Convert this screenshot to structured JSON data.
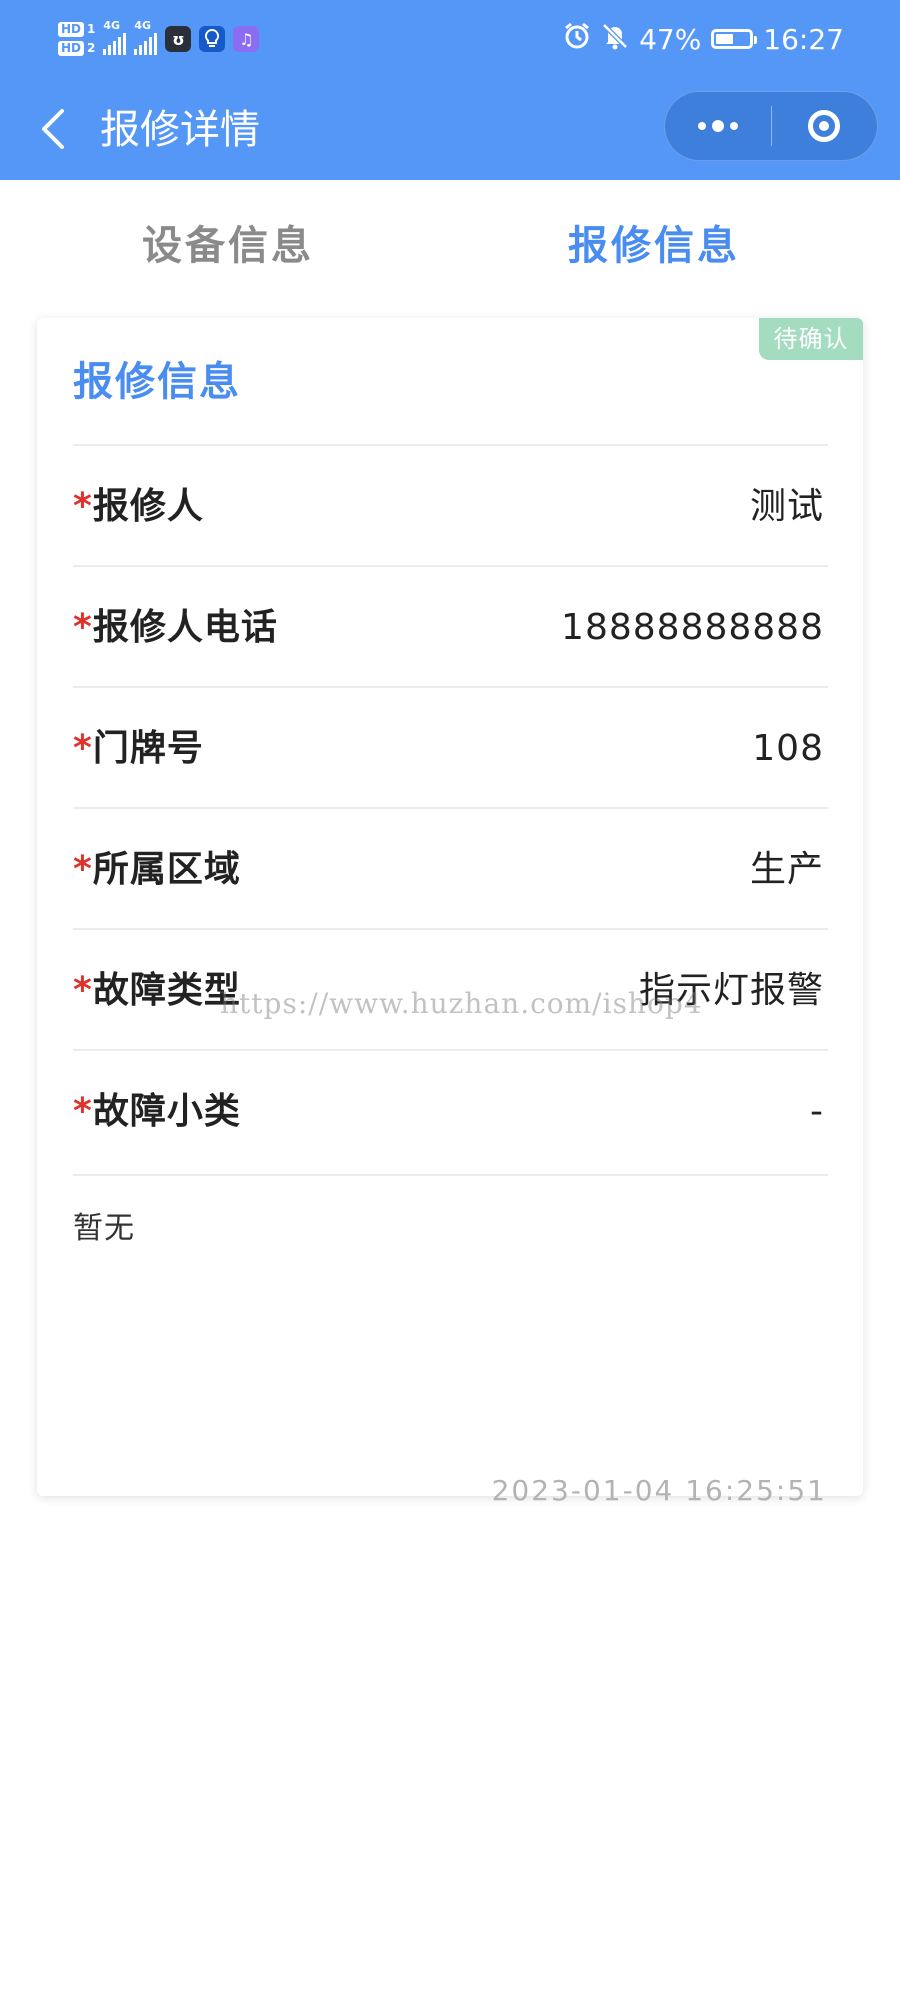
{
  "status_bar": {
    "sim1": "HD",
    "sim1_num": "1",
    "sim2": "HD",
    "sim2_num": "2",
    "net1": "4G",
    "net2": "4G",
    "battery_percent": "47%",
    "battery_level": 0.47,
    "time": "16:27",
    "icons": [
      "alarm-icon",
      "mute-bell-icon",
      "battery-icon"
    ]
  },
  "nav": {
    "title": "报修详情",
    "back_icon": "chevron-left-icon",
    "more_icon": "more-dots-icon",
    "close_icon": "target-icon"
  },
  "tabs": [
    {
      "label": "设备信息",
      "active": false
    },
    {
      "label": "报修信息",
      "active": true
    }
  ],
  "card": {
    "status": "待确认",
    "title": "报修信息",
    "fields": [
      {
        "label": "报修人",
        "value": "测试"
      },
      {
        "label": "报修人电话",
        "value": "18888888888"
      },
      {
        "label": "门牌号",
        "value": "108"
      },
      {
        "label": "所属区域",
        "value": "生产"
      },
      {
        "label": "故障类型",
        "value": "指示灯报警"
      },
      {
        "label": "故障小类",
        "value": "-"
      }
    ],
    "required_mark": "*",
    "remark": "暂无",
    "timestamp": "2023-01-04 16:25:51"
  },
  "watermark": "https://www.huzhan.com/ishop4"
}
